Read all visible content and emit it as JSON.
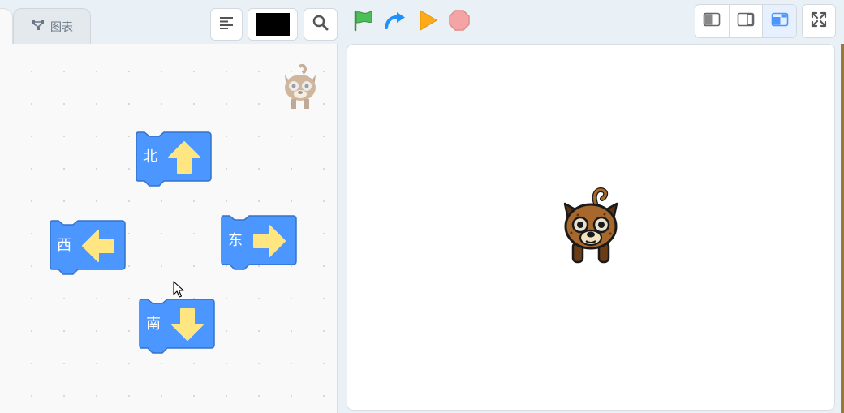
{
  "tabs": {
    "chart_label": "图表"
  },
  "toolbar": {
    "pen_color": "#000000"
  },
  "blocks": [
    {
      "label": "北",
      "direction": "up",
      "icon": "arrow-up-icon"
    },
    {
      "label": "西",
      "direction": "left",
      "icon": "arrow-left-icon"
    },
    {
      "label": "东",
      "direction": "right",
      "icon": "arrow-right-icon"
    },
    {
      "label": "南",
      "direction": "down",
      "icon": "arrow-down-icon"
    }
  ],
  "colors": {
    "block_fill": "#4c97ff",
    "block_stroke": "#3373cc",
    "arrow": "#ffe680",
    "flag": "#4cbf56",
    "step": "#1e90ff",
    "play": "#ffab19",
    "stop": "#f4a4a4"
  }
}
